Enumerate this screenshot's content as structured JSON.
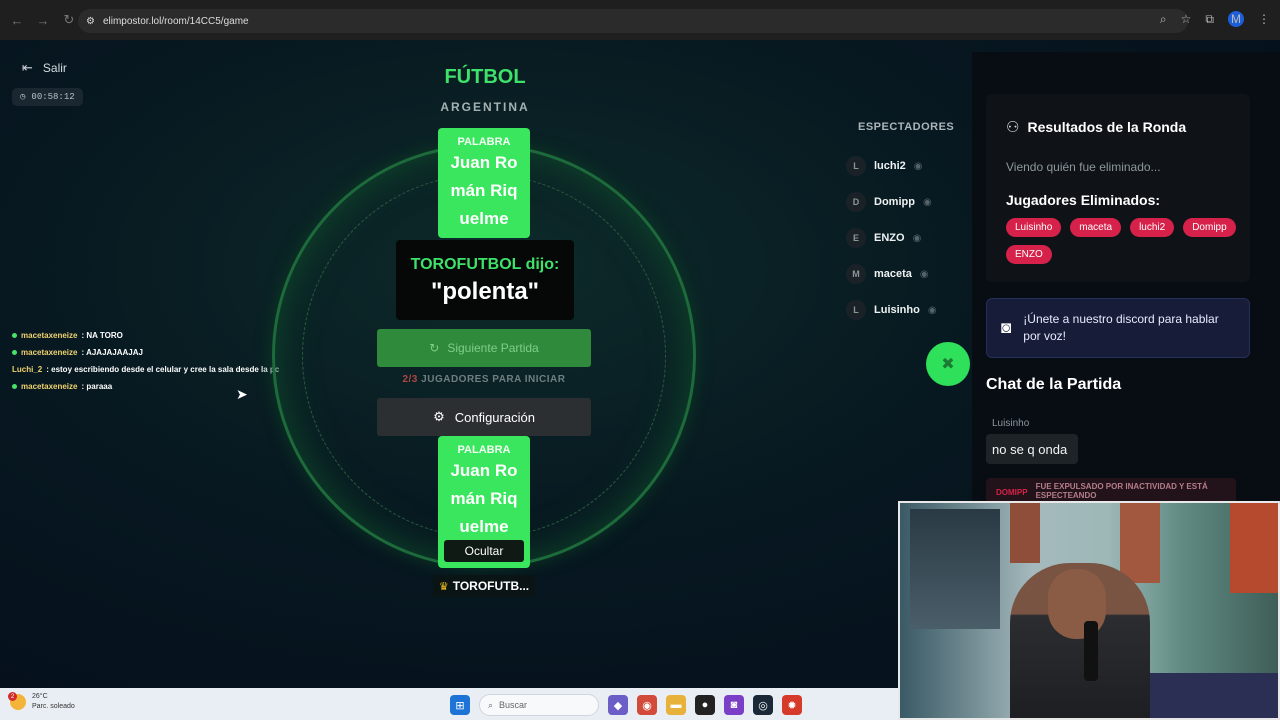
{
  "browser": {
    "url": "elimpostor.lol/room/14CC5/game",
    "profile_initial": "M"
  },
  "sidebar": {
    "exit_label": "Salir",
    "timer": "00:58:12"
  },
  "chatlog": [
    {
      "user": "macetaxeneize",
      "msg": ": NA TORO"
    },
    {
      "user": "macetaxeneize",
      "msg": ": AJAJAJAAJAJ"
    },
    {
      "user": "Luchi_2",
      "msg": ": estoy escribiendo desde el celular y cree la sala desde la pc"
    },
    {
      "user": "macetaxeneize",
      "msg": ": paraaa"
    }
  ],
  "game": {
    "category": "FÚTBOL",
    "subcategory": "ARGENTINA",
    "card_label": "PALABRA",
    "word_lines": [
      "Juan Ro",
      "mán Riq",
      "uelme"
    ],
    "said_who": "TOROFUTBOL dijo:",
    "said_word": "\"polenta\"",
    "next_button": "Siguiente Partida",
    "players_count": "2/3",
    "players_needed": "JUGADORES PARA INICIAR",
    "config_button": "Configuración",
    "hide_button": "Ocultar",
    "host_name": "TOROFUTB..."
  },
  "spectators": {
    "title": "ESPECTADORES",
    "list": [
      {
        "initial": "L",
        "name": "luchi2"
      },
      {
        "initial": "D",
        "name": "Domipp"
      },
      {
        "initial": "E",
        "name": "ENZO"
      },
      {
        "initial": "M",
        "name": "maceta"
      },
      {
        "initial": "L",
        "name": "Luisinho"
      }
    ]
  },
  "results": {
    "title": "Resultados de la Ronda",
    "subtitle": "Viendo quién fue eliminado...",
    "eliminated_title": "Jugadores Eliminados:",
    "eliminated": [
      "Luisinho",
      "maceta",
      "luchi2",
      "Domipp",
      "ENZO"
    ]
  },
  "discord": {
    "text": "¡Únete a nuestro discord para hablar por voz!"
  },
  "chat": {
    "title": "Chat de la Partida",
    "messages": [
      {
        "user": "Luisinho",
        "text": "no se q onda"
      }
    ],
    "system": {
      "user": "DOMIPP",
      "text": "FUE EXPULSADO POR INACTIVIDAD Y ESTÁ ESPECTEANDO"
    }
  },
  "taskbar": {
    "weather_temp": "26°C",
    "weather_desc": "Parc. soleado",
    "weather_badge": "2",
    "search_placeholder": "Buscar"
  },
  "colors": {
    "accent_green": "#3ee26a",
    "card_green": "#39e65d",
    "eliminated_red": "#d6224a",
    "discord": "#171d38"
  }
}
